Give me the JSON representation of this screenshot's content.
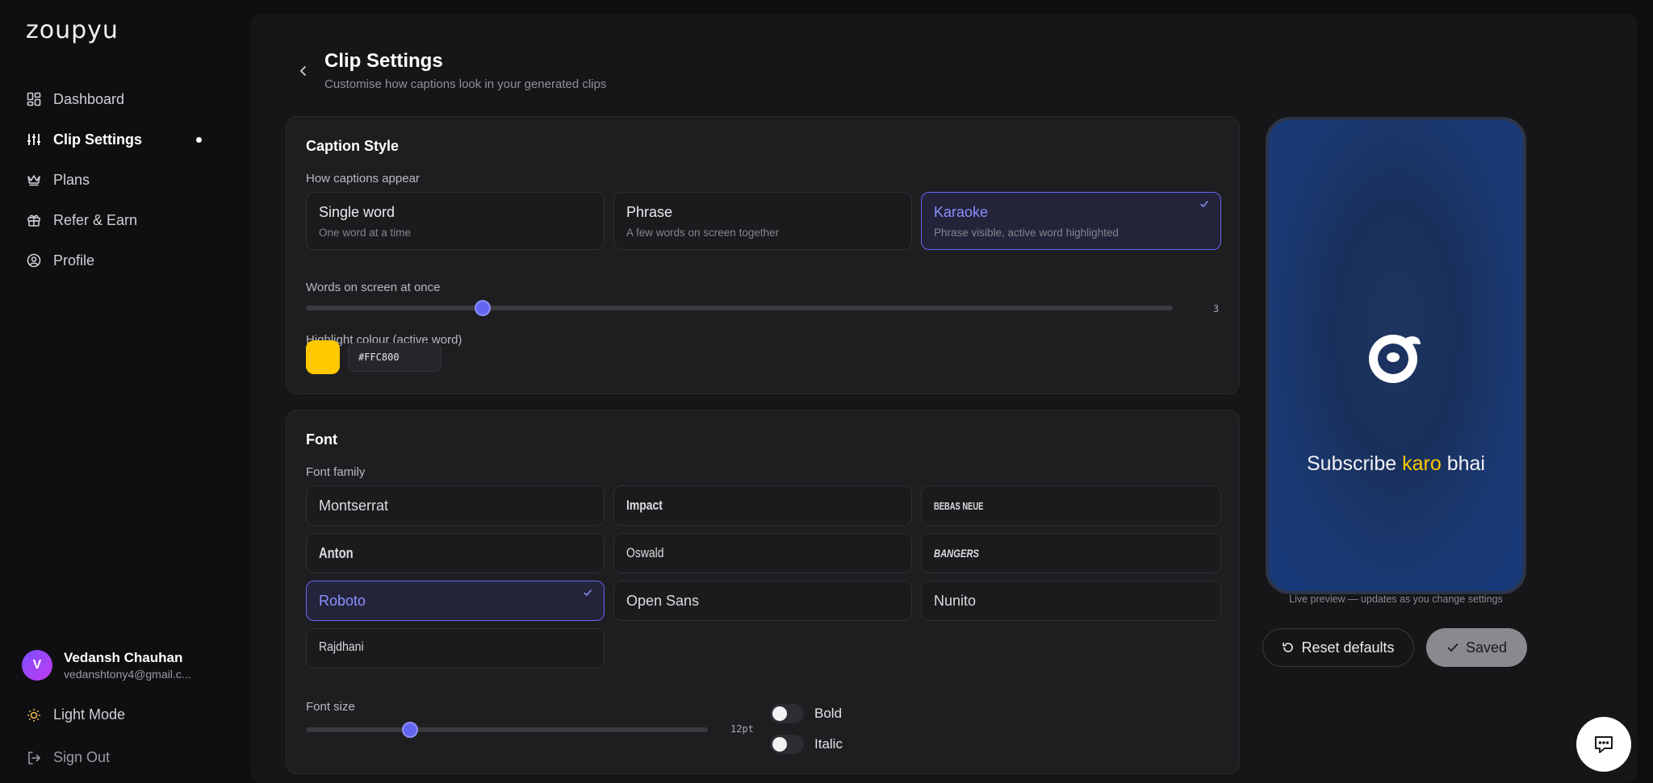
{
  "app": {
    "logo": "zoupyu"
  },
  "sidebar": {
    "items": [
      {
        "label": "Dashboard",
        "icon": "dashboard-icon"
      },
      {
        "label": "Clip Settings",
        "icon": "sliders-icon",
        "active": true
      },
      {
        "label": "Plans",
        "icon": "crown-icon"
      },
      {
        "label": "Refer & Earn",
        "icon": "gift-icon"
      },
      {
        "label": "Profile",
        "icon": "user-circle-icon"
      }
    ],
    "user": {
      "initial": "V",
      "name": "Vedansh Chauhan",
      "email": "vedanshtony4@gmail.c..."
    },
    "light_mode": "Light Mode",
    "sign_out": "Sign Out"
  },
  "header": {
    "title": "Clip Settings",
    "subtitle": "Customise how captions look in your generated clips"
  },
  "caption_style": {
    "title": "Caption Style",
    "how_label": "How captions appear",
    "options": [
      {
        "title": "Single word",
        "desc": "One word at a time"
      },
      {
        "title": "Phrase",
        "desc": "A few words on screen together"
      },
      {
        "title": "Karaoke",
        "desc": "Phrase visible, active word highlighted",
        "selected": true
      }
    ],
    "words_label": "Words on screen at once",
    "words_value": "3",
    "highlight_label": "Highlight colour (active word)",
    "highlight_hex": "#FFC800",
    "highlight_color": "#FFC800"
  },
  "font": {
    "title": "Font",
    "family_label": "Font family",
    "families": [
      "Montserrat",
      "Impact",
      "BEBAS NEUE",
      "Anton",
      "Oswald",
      "BANGERS",
      "Roboto",
      "Open Sans",
      "Nunito",
      "Rajdhani"
    ],
    "selected_family": "Roboto",
    "size_label": "Font size",
    "size_value": "12pt",
    "bold_label": "Bold",
    "italic_label": "Italic",
    "bold_on": false,
    "italic_on": false
  },
  "preview": {
    "caption_before": "Subscribe ",
    "caption_highlight": "karo",
    "caption_after": " bhai",
    "note": "Live preview — updates as you change settings"
  },
  "actions": {
    "reset_label": "Reset defaults",
    "saved_label": "Saved"
  },
  "colors": {
    "accent": "#6366f1",
    "highlight": "#FFC800"
  }
}
